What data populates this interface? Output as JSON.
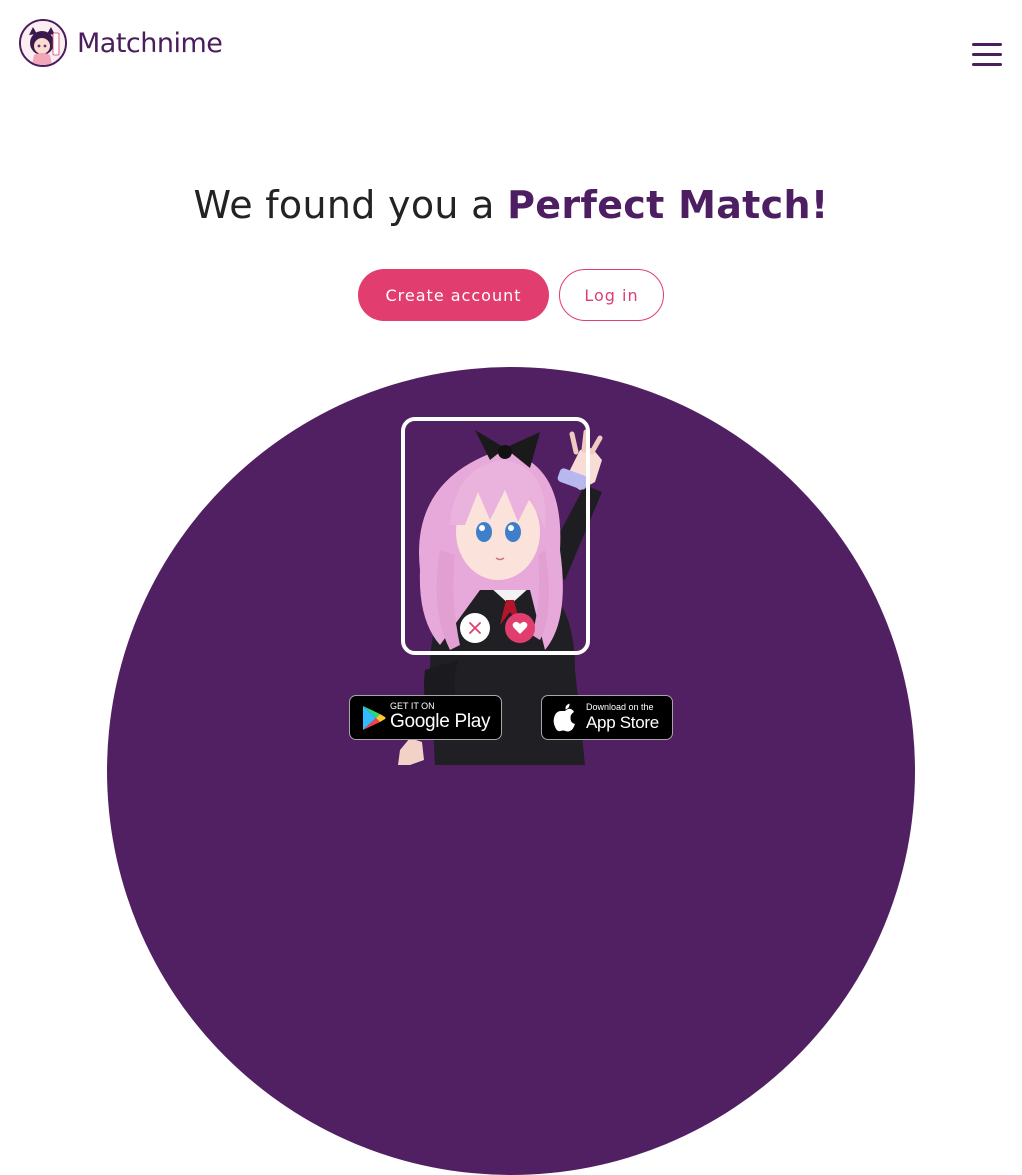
{
  "brand": {
    "name": "Matchnime",
    "color": "#4a1d5c"
  },
  "nav": {
    "menu_icon": "hamburger-menu-icon"
  },
  "hero": {
    "headline_prefix": "We found you a ",
    "headline_accent": "Perfect Match!",
    "accent_color": "#4d1e62",
    "background_color": "#512062"
  },
  "actions": {
    "create_account_label": "Create account",
    "login_label": "Log in",
    "button_color": "#e13d6f"
  },
  "match_card": {
    "reject_icon": "close-icon",
    "like_icon": "heart-icon"
  },
  "stores": {
    "google": {
      "small_text": "GET IT ON",
      "big_text": "Google Play",
      "icon": "google-play-icon"
    },
    "apple": {
      "small_text": "Download on the",
      "big_text": "App Store",
      "icon": "apple-icon"
    }
  }
}
